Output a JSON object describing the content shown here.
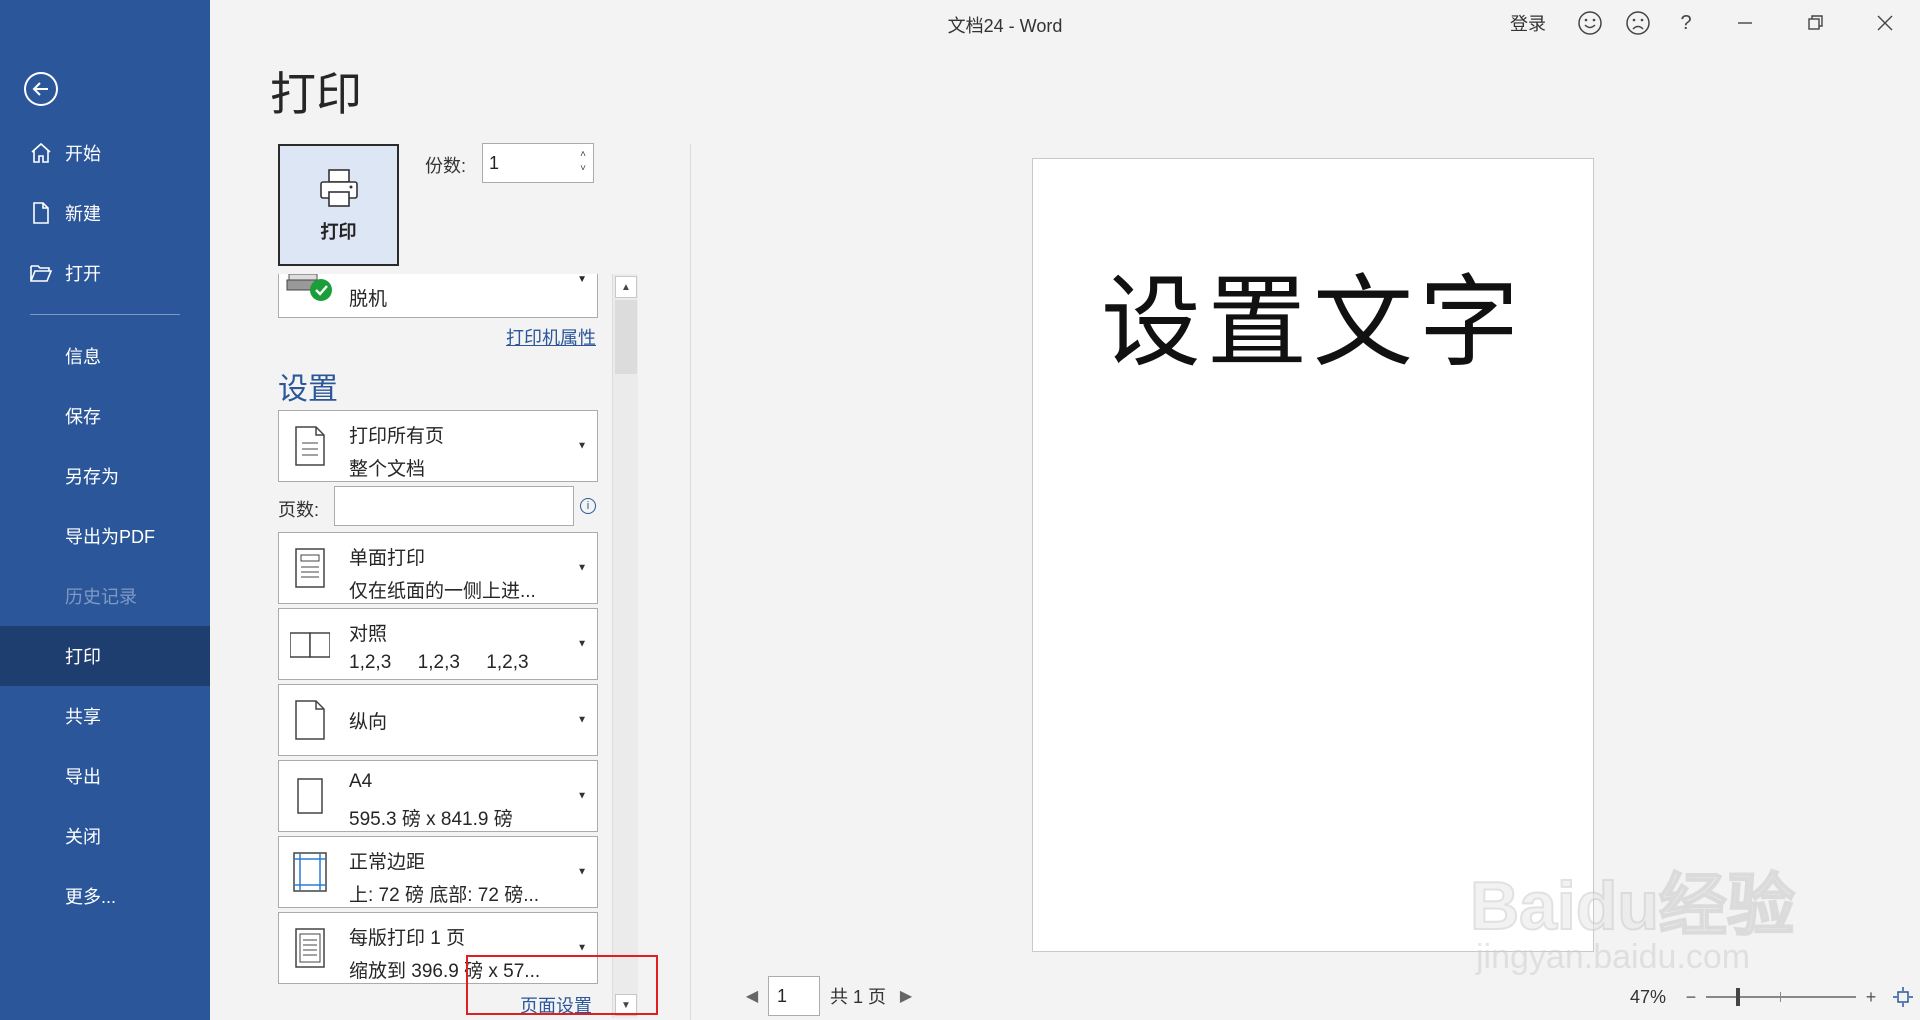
{
  "window": {
    "title": "文档24  -  Word",
    "login": "登录",
    "help": "?"
  },
  "sidebar": {
    "items": [
      {
        "label": "开始",
        "icon": "home-icon"
      },
      {
        "label": "新建",
        "icon": "new-document-icon"
      },
      {
        "label": "打开",
        "icon": "folder-open-icon"
      },
      {
        "label": "信息"
      },
      {
        "label": "保存"
      },
      {
        "label": "另存为"
      },
      {
        "label": "导出为PDF"
      },
      {
        "label": "历史记录",
        "disabled": true
      },
      {
        "label": "打印",
        "active": true
      },
      {
        "label": "共享"
      },
      {
        "label": "导出"
      },
      {
        "label": "关闭"
      },
      {
        "label": "更多..."
      }
    ]
  },
  "print": {
    "heading": "打印",
    "print_button": "打印",
    "copies_label": "份数:",
    "copies_value": "1",
    "printer_name": "脱机",
    "printer_properties": "打印机属性",
    "settings_heading": "设置",
    "pages_label": "页数:",
    "pages_value": "",
    "info": "i",
    "options": [
      {
        "title": "打印所有页",
        "sub": "整个文档",
        "icon": "document-pages-icon"
      },
      {
        "title": "单面打印",
        "sub": "仅在纸面的一侧上进...",
        "icon": "one-sided-icon"
      },
      {
        "title": "对照",
        "sub": "1,2,3     1,2,3     1,2,3",
        "icon": "collated-icon"
      },
      {
        "title": "纵向",
        "sub": "",
        "icon": "portrait-icon"
      },
      {
        "title": "A4",
        "sub": "595.3 磅 x 841.9 磅",
        "icon": "paper-size-icon"
      },
      {
        "title": "正常边距",
        "sub": "上: 72 磅 底部: 72 磅...",
        "icon": "margins-icon"
      },
      {
        "title": "每版打印 1 页",
        "sub": "缩放到 396.9 磅 x 57...",
        "icon": "pages-per-sheet-icon"
      }
    ],
    "page_setup": "页面设置"
  },
  "preview": {
    "document_text": "设置文字",
    "current_page": "1",
    "total_pages": "共 1 页",
    "zoom": "47%",
    "zoom_fraction": 0.47
  },
  "watermark": {
    "brand": "Baidu经验",
    "url": "jingyan.baidu.com"
  }
}
